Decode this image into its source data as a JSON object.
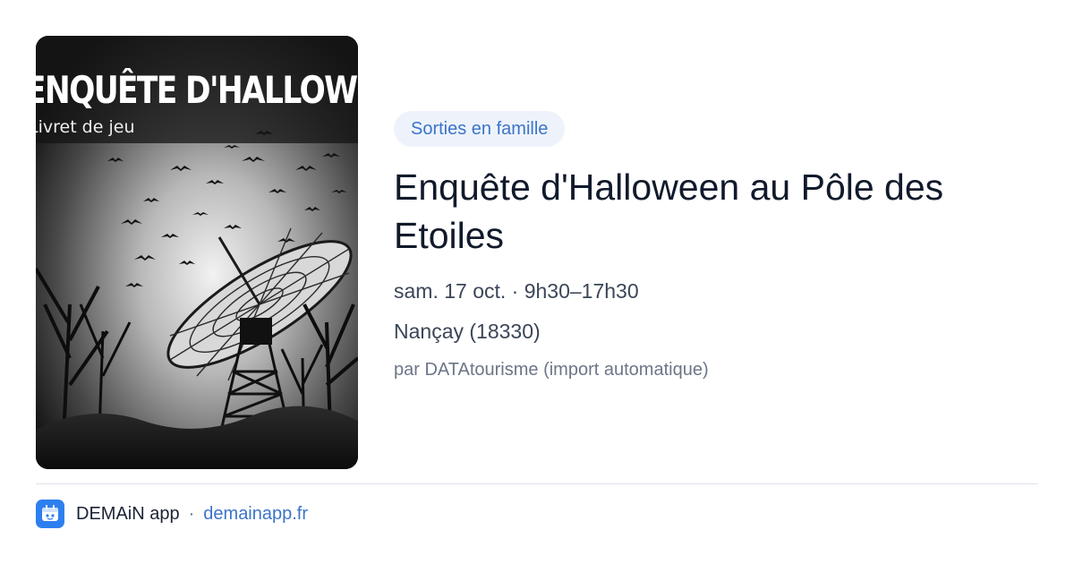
{
  "poster": {
    "title": "ENQUÊTE D'HALLOWEEN",
    "subtitle": "Livret de jeu"
  },
  "event": {
    "category": "Sorties en famille",
    "title": "Enquête d'Halloween au Pôle des Etoiles",
    "when": "sam. 17 oct. · 9h30–17h30",
    "where": "Nançay (18330)",
    "source": "par DATAtourisme (import automatique)"
  },
  "footer": {
    "app_name": "DEMAiN app",
    "separator": "·",
    "link": "demainapp.fr"
  },
  "colors": {
    "accent": "#3b74c9",
    "badge_bg": "#eef3fb",
    "app_icon": "#2d7ff0"
  },
  "icons": {
    "app": "demain-app-icon"
  }
}
